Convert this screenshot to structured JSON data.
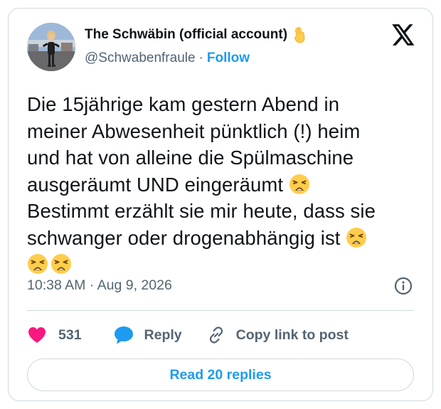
{
  "author": {
    "display_name": "The Schwäbin (official account)",
    "name_emoji": "pinched-fingers-emoji",
    "handle": "@Schwabenfraule",
    "separator": "·",
    "follow_label": "Follow"
  },
  "platform_icon": "x-logo-icon",
  "tweet": {
    "lines": [
      "Die 15jährige kam gestern Abend in",
      "meiner Abwesenheit pünktlich (!) heim",
      "und hat von alleine die Spülmaschine",
      "ausgeräumt UND eingeräumt",
      "Bestimmt erzählt sie mir heute, dass sie",
      "schwanger oder drogenabhängig ist"
    ],
    "emoji_name": "weary-face-emoji"
  },
  "timestamp": "10:38 AM · Aug 9, 2026",
  "actions": {
    "like_count": "531",
    "reply_label": "Reply",
    "copy_label": "Copy link to post"
  },
  "read_replies_label": "Read 20 replies",
  "colors": {
    "accent": "#1d9bf0",
    "like": "#f91880",
    "text": "#0f1419",
    "muted": "#536471",
    "border": "#cfd9de",
    "emoji": "#ffcc4d"
  }
}
